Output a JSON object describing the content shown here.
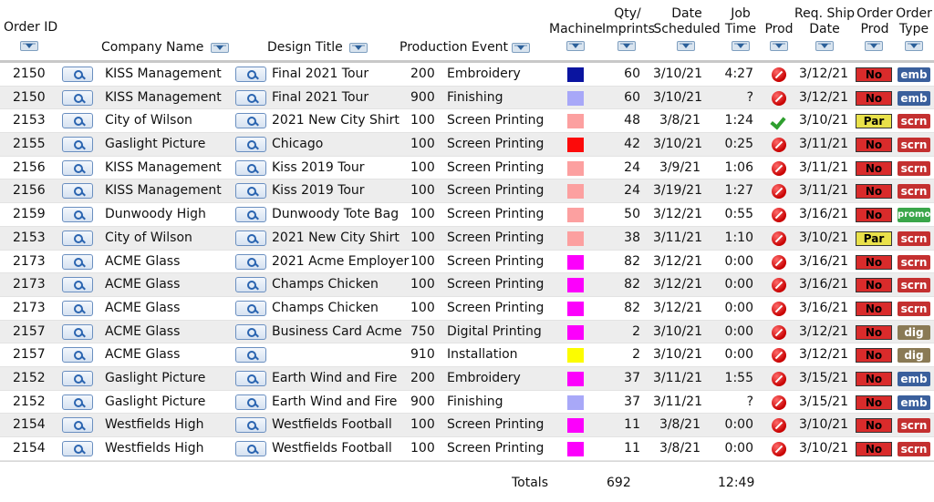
{
  "headers": {
    "order_id": "Order ID",
    "company": "Company Name",
    "design": "Design Title",
    "event": "Production Event",
    "machine": "Machine",
    "qty_line1": "Qty/",
    "qty_line2": "Imprints",
    "date_line1": "Date",
    "date_line2": "Scheduled",
    "job_line1": "Job",
    "job_line2": "Time",
    "prod": "Prod",
    "ship_line1": "Req. Ship",
    "ship_line2": "Date",
    "oprod_line1": "Order",
    "oprod_line2": "Prod",
    "otype_line1": "Order",
    "otype_line2": "Type"
  },
  "colors": {
    "navy": "#0a14a0",
    "lavender": "#a8a8f8",
    "salmon": "#fca0a0",
    "red": "#fc0a0a",
    "magenta": "#fc00fc",
    "yellow": "#fcfc00"
  },
  "rows": [
    {
      "order": "2150",
      "company": "KISS Management",
      "design": "Final 2021 Tour",
      "code": "200",
      "event": "Embroidery",
      "machine": "navy",
      "qty": "60",
      "date": "3/10/21",
      "time": "4:27",
      "prod": "x",
      "ship": "3/12/21",
      "oprod": "No",
      "otype": "emb"
    },
    {
      "order": "2150",
      "company": "KISS Management",
      "design": "Final 2021 Tour",
      "code": "900",
      "event": "Finishing",
      "machine": "lavender",
      "qty": "60",
      "date": "3/10/21",
      "time": "?",
      "prod": "x",
      "ship": "3/12/21",
      "oprod": "No",
      "otype": "emb"
    },
    {
      "order": "2153",
      "company": "City of Wilson",
      "design": "2021 New City Shirt",
      "code": "100",
      "event": "Screen Printing",
      "machine": "salmon",
      "qty": "48",
      "date": "3/8/21",
      "time": "1:24",
      "prod": "check",
      "ship": "3/10/21",
      "oprod": "Par",
      "otype": "scrn"
    },
    {
      "order": "2155",
      "company": "Gaslight Picture",
      "design": "Chicago",
      "code": "100",
      "event": "Screen Printing",
      "machine": "red",
      "qty": "42",
      "date": "3/10/21",
      "time": "0:25",
      "prod": "x",
      "ship": "3/11/21",
      "oprod": "No",
      "otype": "scrn"
    },
    {
      "order": "2156",
      "company": "KISS Management",
      "design": "Kiss 2019 Tour",
      "code": "100",
      "event": "Screen Printing",
      "machine": "salmon",
      "qty": "24",
      "date": "3/9/21",
      "time": "1:06",
      "prod": "x",
      "ship": "3/11/21",
      "oprod": "No",
      "otype": "scrn"
    },
    {
      "order": "2156",
      "company": "KISS Management",
      "design": "Kiss 2019 Tour",
      "code": "100",
      "event": "Screen Printing",
      "machine": "salmon",
      "qty": "24",
      "date": "3/19/21",
      "time": "1:27",
      "prod": "x",
      "ship": "3/11/21",
      "oprod": "No",
      "otype": "scrn"
    },
    {
      "order": "2159",
      "company": "Dunwoody High",
      "design": "Dunwoody Tote Bag",
      "code": "100",
      "event": "Screen Printing",
      "machine": "salmon",
      "qty": "50",
      "date": "3/12/21",
      "time": "0:55",
      "prod": "x",
      "ship": "3/16/21",
      "oprod": "No",
      "otype": "promo"
    },
    {
      "order": "2153",
      "company": "City of Wilson",
      "design": "2021 New City Shirt",
      "code": "100",
      "event": "Screen Printing",
      "machine": "salmon",
      "qty": "38",
      "date": "3/11/21",
      "time": "1:10",
      "prod": "x",
      "ship": "3/10/21",
      "oprod": "Par",
      "otype": "scrn"
    },
    {
      "order": "2173",
      "company": "ACME Glass",
      "design": "2021 Acme Employer",
      "code": "100",
      "event": "Screen Printing",
      "machine": "magenta",
      "qty": "82",
      "date": "3/12/21",
      "time": "0:00",
      "prod": "x",
      "ship": "3/16/21",
      "oprod": "No",
      "otype": "scrn"
    },
    {
      "order": "2173",
      "company": "ACME Glass",
      "design": "Champs Chicken",
      "code": "100",
      "event": "Screen Printing",
      "machine": "magenta",
      "qty": "82",
      "date": "3/12/21",
      "time": "0:00",
      "prod": "x",
      "ship": "3/16/21",
      "oprod": "No",
      "otype": "scrn"
    },
    {
      "order": "2173",
      "company": "ACME Glass",
      "design": "Champs Chicken",
      "code": "100",
      "event": "Screen Printing",
      "machine": "magenta",
      "qty": "82",
      "date": "3/12/21",
      "time": "0:00",
      "prod": "x",
      "ship": "3/16/21",
      "oprod": "No",
      "otype": "scrn"
    },
    {
      "order": "2157",
      "company": "ACME Glass",
      "design": "Business Card Acme",
      "code": "750",
      "event": "Digital Printing",
      "machine": "magenta",
      "qty": "2",
      "date": "3/10/21",
      "time": "0:00",
      "prod": "x",
      "ship": "3/12/21",
      "oprod": "No",
      "otype": "dig"
    },
    {
      "order": "2157",
      "company": "ACME Glass",
      "design": "",
      "code": "910",
      "event": "Installation",
      "machine": "yellow",
      "qty": "2",
      "date": "3/10/21",
      "time": "0:00",
      "prod": "x",
      "ship": "3/12/21",
      "oprod": "No",
      "otype": "dig"
    },
    {
      "order": "2152",
      "company": "Gaslight Picture",
      "design": "Earth Wind and Fire",
      "code": "200",
      "event": "Embroidery",
      "machine": "magenta",
      "qty": "37",
      "date": "3/11/21",
      "time": "1:55",
      "prod": "x",
      "ship": "3/15/21",
      "oprod": "No",
      "otype": "emb"
    },
    {
      "order": "2152",
      "company": "Gaslight Picture",
      "design": "Earth Wind and Fire",
      "code": "900",
      "event": "Finishing",
      "machine": "lavender",
      "qty": "37",
      "date": "3/11/21",
      "time": "?",
      "prod": "x",
      "ship": "3/15/21",
      "oprod": "No",
      "otype": "emb"
    },
    {
      "order": "2154",
      "company": "Westfields High",
      "design": "Westfields Football",
      "code": "100",
      "event": "Screen Printing",
      "machine": "magenta",
      "qty": "11",
      "date": "3/8/21",
      "time": "0:00",
      "prod": "x",
      "ship": "3/10/21",
      "oprod": "No",
      "otype": "scrn"
    },
    {
      "order": "2154",
      "company": "Westfields High",
      "design": "Westfields Football",
      "code": "100",
      "event": "Screen Printing",
      "machine": "magenta",
      "qty": "11",
      "date": "3/8/21",
      "time": "0:00",
      "prod": "x",
      "ship": "3/10/21",
      "oprod": "No",
      "otype": "scrn"
    }
  ],
  "totals": {
    "label": "Totals",
    "qty": "692",
    "time": "12:49"
  }
}
